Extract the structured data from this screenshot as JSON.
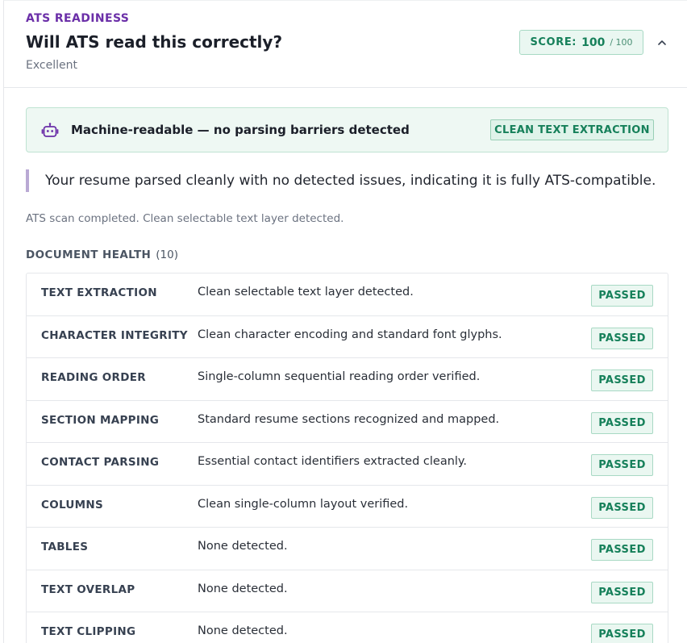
{
  "header": {
    "eyebrow": "ATS READINESS",
    "title": "Will ATS read this correctly?",
    "subtitle": "Excellent",
    "score_label": "SCORE:",
    "score_value": "100",
    "score_max": "/ 100"
  },
  "banner": {
    "icon": "robot-icon",
    "text": "Machine-readable — no parsing barriers detected",
    "badge": "CLEAN TEXT EXTRACTION"
  },
  "summary": "Your resume parsed cleanly with no detected issues, indicating it is fully ATS-compatible.",
  "scan_status": "ATS scan completed. Clean selectable text layer detected.",
  "document_health": {
    "title": "DOCUMENT HEALTH",
    "count": "(10)",
    "rows": [
      {
        "name": "TEXT EXTRACTION",
        "desc": "Clean selectable text layer detected.",
        "status": "PASSED"
      },
      {
        "name": "CHARACTER INTEGRITY",
        "desc": "Clean character encoding and standard font glyphs.",
        "status": "PASSED"
      },
      {
        "name": "READING ORDER",
        "desc": "Single-column sequential reading order verified.",
        "status": "PASSED"
      },
      {
        "name": "SECTION MAPPING",
        "desc": "Standard resume sections recognized and mapped.",
        "status": "PASSED"
      },
      {
        "name": "CONTACT PARSING",
        "desc": "Essential contact identifiers extracted cleanly.",
        "status": "PASSED"
      },
      {
        "name": "COLUMNS",
        "desc": "Clean single-column layout verified.",
        "status": "PASSED"
      },
      {
        "name": "TABLES",
        "desc": "None detected.",
        "status": "PASSED"
      },
      {
        "name": "TEXT OVERLAP",
        "desc": "None detected.",
        "status": "PASSED"
      },
      {
        "name": "TEXT CLIPPING",
        "desc": "None detected.",
        "status": "PASSED"
      }
    ]
  },
  "colors": {
    "accent_purple": "#6b2fa8",
    "success_green": "#16805a",
    "success_bg": "#eaf7f1"
  }
}
